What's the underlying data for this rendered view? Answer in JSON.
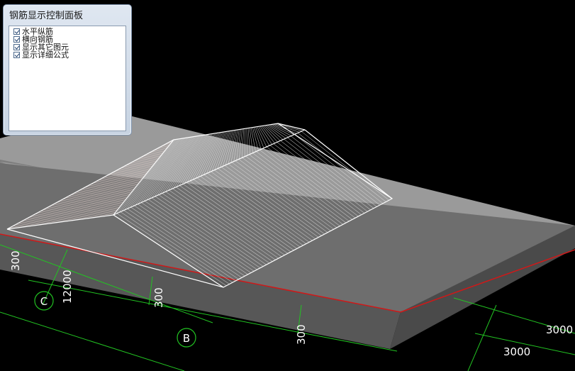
{
  "panel": {
    "title": "钢筋显示控制面板",
    "options": [
      {
        "label": "水平纵筋",
        "checked": true
      },
      {
        "label": "横向钢筋",
        "checked": true
      },
      {
        "label": "显示其它图元",
        "checked": true
      },
      {
        "label": "显示详细公式",
        "checked": true
      }
    ]
  },
  "axes": {
    "c_label": "C",
    "b_label": "B",
    "dim_12000": "12000",
    "dim_3000_a": "300",
    "dim_3000_b": "300",
    "dim_3000_c": "300",
    "dim_3000_right_top": "3000",
    "dim_3000_right_bottom": "3000"
  },
  "colors": {
    "background": "#000000",
    "slab_top": "#8a8a8a",
    "slab_top_far": "#9c9c9c",
    "slab_side": "#5c5c5c",
    "grid": "#22c322",
    "edge_red": "#d01818",
    "rebar_white": "#ffffff"
  }
}
